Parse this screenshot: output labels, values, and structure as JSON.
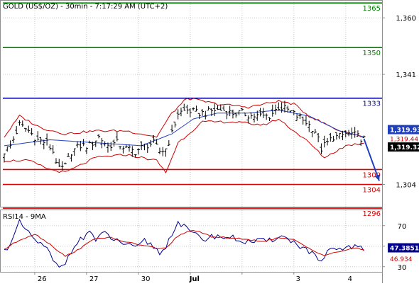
{
  "header": {
    "title": "GOLD (US$/OZ) - 30min - 7:17:29 AM (UTC+2)"
  },
  "colors": {
    "price": "#000000",
    "bollinger": "#cc0000",
    "moving_average": "#1f3fbf",
    "support": "#dd0000",
    "resistance_green": "#008000",
    "resistance_blue": "#00008b",
    "forecast_arrow": "#1f3fbf",
    "rsi": "#00008b",
    "rsi_ma": "#cc0000",
    "grid": "#c8c8c8",
    "panel_border": "#8e8e8e",
    "price_badge": "#000000",
    "ma_badge": "#1f3fbf"
  },
  "chart_data": [
    {
      "type": "candlestick",
      "title": "GOLD (US$/OZ) - 30min - 7:17:29 AM (UTC+2)",
      "ylim": [
        1296.5,
        1366.0
      ],
      "y_ticks": [
        "1,360",
        "1,341",
        "1,304"
      ],
      "y_tick_values": [
        1360,
        1341,
        1304
      ],
      "x_tick_labels": [
        "26",
        "27",
        "30",
        "Jul",
        "3",
        "4"
      ],
      "grid": true,
      "horizontal_levels": [
        {
          "label": "1365",
          "value": 1365,
          "color": "#008000"
        },
        {
          "label": "1350",
          "value": 1350,
          "color": "#008000"
        },
        {
          "label": "1333",
          "value": 1333,
          "color": "#00008b"
        },
        {
          "label": "1309",
          "value": 1309,
          "color": "#dd0000"
        },
        {
          "label": "1304",
          "value": 1304,
          "color": "#dd0000"
        },
        {
          "label": "1296",
          "value": 1296,
          "color": "#dd0000"
        }
      ],
      "last_values": [
        {
          "label": "1,319.93",
          "value": 1319.93,
          "badge": "ma"
        },
        {
          "label": "1,319.44",
          "value": 1319.44,
          "badge": "none"
        },
        {
          "label": "1,319.32",
          "value": 1319.32,
          "badge": "price"
        }
      ],
      "price_anchors": [
        [
          0,
          1315
        ],
        [
          2,
          1317
        ],
        [
          5,
          1324
        ],
        [
          8,
          1322
        ],
        [
          11,
          1319
        ],
        [
          14,
          1318
        ],
        [
          16,
          1315
        ],
        [
          18,
          1309
        ],
        [
          20,
          1310
        ],
        [
          22,
          1315
        ],
        [
          25,
          1317
        ],
        [
          28,
          1317
        ],
        [
          31,
          1320
        ],
        [
          34,
          1317
        ],
        [
          37,
          1318
        ],
        [
          40,
          1316
        ],
        [
          43,
          1315
        ],
        [
          46,
          1317
        ],
        [
          49,
          1318
        ],
        [
          51,
          1315
        ],
        [
          53,
          1316
        ],
        [
          55,
          1321
        ],
        [
          57,
          1328
        ],
        [
          60,
          1329
        ],
        [
          63,
          1328
        ],
        [
          66,
          1328
        ],
        [
          69,
          1329
        ],
        [
          72,
          1329
        ],
        [
          75,
          1328
        ],
        [
          78,
          1328
        ],
        [
          81,
          1327
        ],
        [
          84,
          1327
        ],
        [
          87,
          1327
        ],
        [
          89,
          1329
        ],
        [
          90,
          1330
        ],
        [
          93,
          1329
        ],
        [
          96,
          1327
        ],
        [
          99,
          1325
        ],
        [
          102,
          1322
        ],
        [
          104,
          1316
        ],
        [
          106,
          1318
        ],
        [
          108,
          1320
        ],
        [
          110,
          1320
        ],
        [
          112,
          1321
        ],
        [
          114,
          1321
        ],
        [
          116,
          1320
        ],
        [
          118,
          1319.3
        ]
      ],
      "ma_anchors": [
        [
          0,
          1317
        ],
        [
          15,
          1319
        ],
        [
          30,
          1318
        ],
        [
          45,
          1317
        ],
        [
          55,
          1321
        ],
        [
          62,
          1326
        ],
        [
          70,
          1328
        ],
        [
          80,
          1328
        ],
        [
          90,
          1329
        ],
        [
          100,
          1327
        ],
        [
          110,
          1322
        ],
        [
          118,
          1320
        ]
      ],
      "bollinger_upper_anchors": [
        [
          0,
          1320
        ],
        [
          5,
          1327
        ],
        [
          12,
          1323
        ],
        [
          20,
          1321
        ],
        [
          30,
          1322
        ],
        [
          40,
          1322
        ],
        [
          50,
          1320
        ],
        [
          55,
          1328
        ],
        [
          60,
          1333
        ],
        [
          70,
          1331
        ],
        [
          80,
          1330
        ],
        [
          90,
          1332
        ],
        [
          95,
          1331
        ],
        [
          100,
          1327
        ],
        [
          110,
          1322
        ],
        [
          118,
          1320
        ]
      ],
      "bollinger_lower_anchors": [
        [
          0,
          1312
        ],
        [
          8,
          1312
        ],
        [
          15,
          1309
        ],
        [
          20,
          1308
        ],
        [
          30,
          1313
        ],
        [
          40,
          1314
        ],
        [
          50,
          1312
        ],
        [
          53,
          1308
        ],
        [
          57,
          1318
        ],
        [
          65,
          1325
        ],
        [
          75,
          1325
        ],
        [
          85,
          1324
        ],
        [
          90,
          1326
        ],
        [
          100,
          1318
        ],
        [
          105,
          1313
        ],
        [
          112,
          1317
        ],
        [
          118,
          1318
        ]
      ],
      "forecast_arrow": {
        "from": [
          118,
          1319.3
        ],
        "to": [
          123,
          1305.2
        ]
      }
    },
    {
      "type": "line",
      "title": "RSI14 - 9MA",
      "ylim": [
        25,
        85
      ],
      "y_ticks": [
        "70",
        "50",
        "30"
      ],
      "y_tick_values": [
        70,
        50,
        30
      ],
      "last_values": [
        {
          "label": "47.3851",
          "value": 47.3851,
          "badge": "rsi"
        },
        {
          "label": "46.934",
          "value": 46.934,
          "badge": "none"
        }
      ],
      "series": [
        {
          "key": "rsi",
          "color": "#00008b",
          "anchors": [
            [
              0,
              45
            ],
            [
              3,
              58
            ],
            [
              5,
              73
            ],
            [
              8,
              62
            ],
            [
              11,
              54
            ],
            [
              14,
              47
            ],
            [
              16,
              36
            ],
            [
              18,
              28
            ],
            [
              20,
              34
            ],
            [
              23,
              52
            ],
            [
              26,
              58
            ],
            [
              28,
              66
            ],
            [
              30,
              55
            ],
            [
              33,
              63
            ],
            [
              36,
              56
            ],
            [
              40,
              52
            ],
            [
              43,
              47
            ],
            [
              46,
              55
            ],
            [
              49,
              50
            ],
            [
              51,
              43
            ],
            [
              53,
              49
            ],
            [
              55,
              63
            ],
            [
              57,
              74
            ],
            [
              60,
              66
            ],
            [
              63,
              60
            ],
            [
              66,
              57
            ],
            [
              69,
              60
            ],
            [
              72,
              59
            ],
            [
              75,
              58
            ],
            [
              78,
              55
            ],
            [
              81,
              54
            ],
            [
              84,
              55
            ],
            [
              87,
              55
            ],
            [
              89,
              58
            ],
            [
              90,
              61
            ],
            [
              93,
              57
            ],
            [
              96,
              52
            ],
            [
              99,
              47
            ],
            [
              102,
              40
            ],
            [
              104,
              34
            ],
            [
              106,
              43
            ],
            [
              108,
              47
            ],
            [
              110,
              46
            ],
            [
              112,
              49
            ],
            [
              114,
              50
            ],
            [
              116,
              48
            ],
            [
              118,
              47.4
            ]
          ]
        },
        {
          "key": "rsi_ma",
          "color": "#cc0000",
          "anchors": [
            [
              0,
              47
            ],
            [
              5,
              56
            ],
            [
              10,
              62
            ],
            [
              15,
              52
            ],
            [
              20,
              40
            ],
            [
              25,
              48
            ],
            [
              30,
              58
            ],
            [
              35,
              58
            ],
            [
              40,
              54
            ],
            [
              45,
              51
            ],
            [
              50,
              48
            ],
            [
              53,
              48
            ],
            [
              57,
              60
            ],
            [
              62,
              66
            ],
            [
              68,
              59
            ],
            [
              75,
              58
            ],
            [
              80,
              56
            ],
            [
              85,
              55
            ],
            [
              90,
              58
            ],
            [
              95,
              56
            ],
            [
              100,
              48
            ],
            [
              105,
              41
            ],
            [
              110,
              45
            ],
            [
              115,
              48
            ],
            [
              118,
              46.9
            ]
          ]
        }
      ]
    }
  ]
}
